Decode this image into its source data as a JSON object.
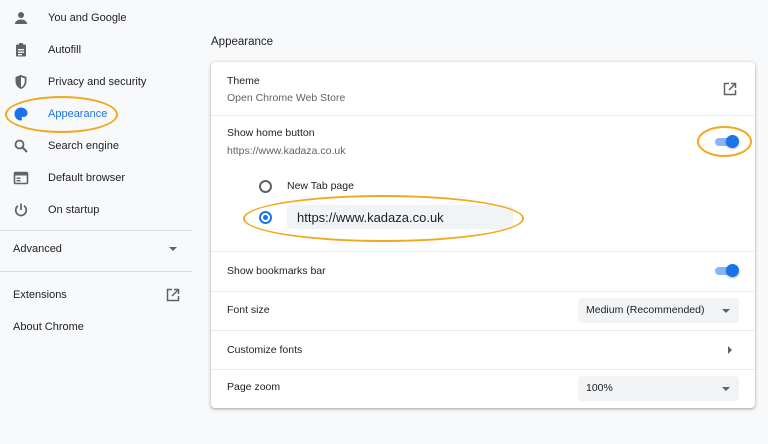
{
  "sidebar": {
    "items": [
      {
        "label": "You and Google",
        "icon": "person-icon"
      },
      {
        "label": "Autofill",
        "icon": "clipboard-icon"
      },
      {
        "label": "Privacy and security",
        "icon": "shield-icon"
      },
      {
        "label": "Appearance",
        "icon": "palette-icon",
        "active": true
      },
      {
        "label": "Search engine",
        "icon": "search-icon"
      },
      {
        "label": "Default browser",
        "icon": "browser-window-icon"
      },
      {
        "label": "On startup",
        "icon": "power-icon"
      }
    ],
    "advanced_label": "Advanced",
    "extensions_label": "Extensions",
    "about_label": "About Chrome"
  },
  "main": {
    "section_title": "Appearance",
    "theme": {
      "label": "Theme",
      "sub": "Open Chrome Web Store"
    },
    "home_button": {
      "label": "Show home button",
      "sub": "https://www.kadaza.co.uk",
      "enabled": true,
      "options": {
        "new_tab_label": "New Tab page",
        "custom_url_value": "https://www.kadaza.co.uk",
        "selected": "custom"
      }
    },
    "bookmarks_bar": {
      "label": "Show bookmarks bar",
      "enabled": true
    },
    "font_size": {
      "label": "Font size",
      "value": "Medium (Recommended)"
    },
    "customize_fonts": {
      "label": "Customize fonts"
    },
    "page_zoom": {
      "label": "Page zoom",
      "value": "100%"
    }
  },
  "colors": {
    "accent": "#1a73e8",
    "annotation": "#f1a81e"
  }
}
